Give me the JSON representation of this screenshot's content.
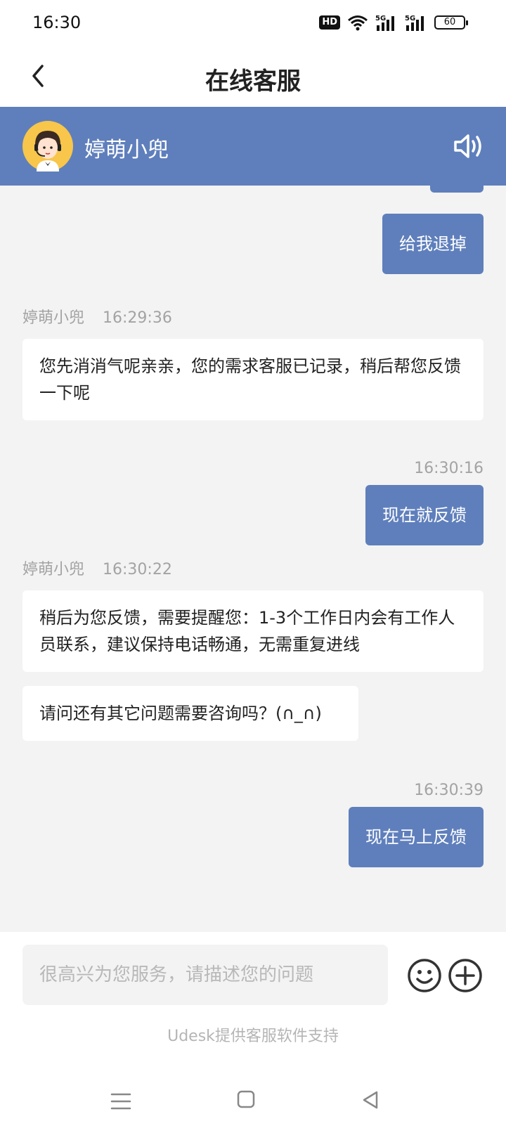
{
  "status_bar": {
    "time": "16:30",
    "hd_label": "HD",
    "battery": "60",
    "icons": [
      "hd-icon",
      "wifi-icon",
      "5g-signal-icon",
      "5g-signal-icon",
      "battery-icon"
    ]
  },
  "header": {
    "title": "在线客服",
    "back_icon": "chevron-left-icon"
  },
  "agent": {
    "name": "婷萌小兜",
    "avatar_icon": "agent-avatar",
    "speaker_icon": "speaker-icon"
  },
  "messages": [
    {
      "side": "out",
      "text": "给我退掉"
    },
    {
      "side": "in",
      "sender": "婷萌小兜",
      "time": "16:29:36",
      "text": "您先消消气呢亲亲，您的需求客服已记录，稍后帮您反馈一下呢"
    },
    {
      "side": "out",
      "time": "16:30:16",
      "text": "现在就反馈"
    },
    {
      "side": "in",
      "sender": "婷萌小兜",
      "time": "16:30:22",
      "text": "稍后为您反馈，需要提醒您：1-3个工作日内会有工作人员联系，建议保持电话畅通，无需重复进线"
    },
    {
      "side": "in",
      "text": "请问还有其它问题需要咨询吗？(∩_∩)"
    },
    {
      "side": "out",
      "time": "16:30:39",
      "text": "现在马上反馈"
    }
  ],
  "composer": {
    "placeholder": "很高兴为您服务，请描述您的问题",
    "emoji_icon": "emoji-icon",
    "plus_icon": "plus-icon",
    "powered_by": "Udesk提供客服软件支持"
  },
  "colors": {
    "accent": "#5f7fbc",
    "background": "#f3f3f3",
    "bubble_in": "#ffffff",
    "meta_text": "#a3a3a3"
  }
}
